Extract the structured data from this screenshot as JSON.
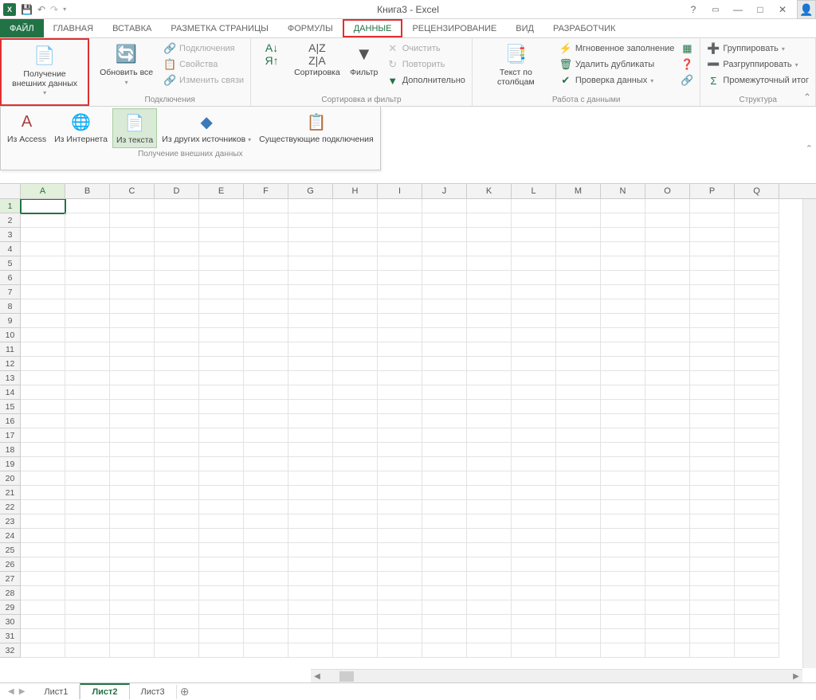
{
  "title": "Книга3 - Excel",
  "tabs": [
    "ФАЙЛ",
    "ГЛАВНАЯ",
    "ВСТАВКА",
    "РАЗМЕТКА СТРАНИЦЫ",
    "ФОРМУЛЫ",
    "ДАННЫЕ",
    "РЕЦЕНЗИРОВАНИЕ",
    "ВИД",
    "РАЗРАБОТЧИК"
  ],
  "active_tab": "ДАННЫЕ",
  "ribbon": {
    "get_data": {
      "label": "Получение внешних данных",
      "btn1": "Получение",
      "btn2": "внешних данных"
    },
    "connections": {
      "label": "Подключения",
      "refresh": "Обновить все",
      "conn": "Подключения",
      "props": "Свойства",
      "links": "Изменить связи"
    },
    "sortfilter": {
      "label": "Сортировка и фильтр",
      "sort": "Сортировка",
      "filter": "Фильтр",
      "clear": "Очистить",
      "reapply": "Повторить",
      "adv": "Дополнительно"
    },
    "datatools": {
      "label": "Работа с данными",
      "t2c": "Текст по столбцам",
      "flash": "Мгновенное заполнение",
      "dup": "Удалить дубликаты",
      "valid": "Проверка данных"
    },
    "outline": {
      "label": "Структура",
      "group": "Группировать",
      "ungroup": "Разгруппировать",
      "subtotal": "Промежуточный итог"
    }
  },
  "dropdown": {
    "label": "Получение внешних данных",
    "access": "Из Access",
    "web": "Из Интернета",
    "text": "Из текста",
    "other": "Из других источников",
    "existing": "Существующие подключения"
  },
  "columns": [
    "A",
    "B",
    "C",
    "D",
    "E",
    "F",
    "G",
    "H",
    "I",
    "J",
    "K",
    "L",
    "M",
    "N",
    "O",
    "P",
    "Q"
  ],
  "rows": 32,
  "active_cell": "A1",
  "sheets": [
    "Лист1",
    "Лист2",
    "Лист3"
  ],
  "active_sheet": "Лист2"
}
